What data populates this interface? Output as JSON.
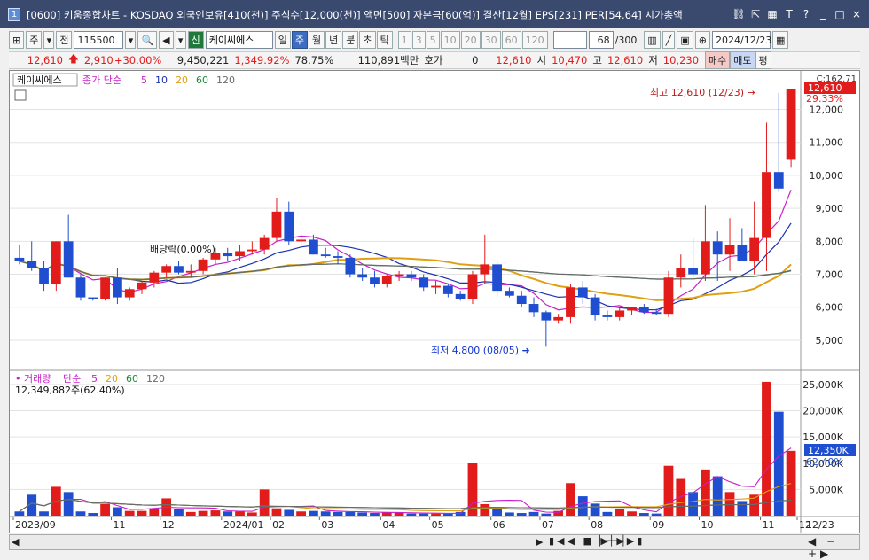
{
  "window": {
    "num": "1",
    "title": "[0600] 키움종합차트 - KOSDAQ 외국인보유[410(천)] 주식수[12,000(천)] 액면[500] 자본금[60(억)] 결산[12월] EPS[231] PER[54.64] 시가총액"
  },
  "toolbar": {
    "period_sel": "주",
    "prev_label": "전",
    "code": "115500",
    "credit_label": "신",
    "stock_name": "케이씨에스",
    "tabs": [
      "일",
      "주",
      "월",
      "년",
      "분",
      "초",
      "틱"
    ],
    "active_tab": "주",
    "nums": [
      "1",
      "3",
      "5",
      "10",
      "20",
      "30",
      "60",
      "120"
    ],
    "count": "68",
    "count_total": "/300",
    "date": "2024/12/23"
  },
  "quote": {
    "price": "12,610",
    "change": "2,910",
    "change_pct": "+30.00%",
    "volume": "9,450,221",
    "vol_ratio": "1,349.92%",
    "turnover": "78.75%",
    "amount": "110,891백만",
    "hoga_label": "호가",
    "hoga": "0",
    "last": "12,610",
    "open_label": "시",
    "open": "10,470",
    "high_label": "고",
    "high": "12,610",
    "low_label": "저",
    "low": "10,230",
    "buy": "매수",
    "sell": "매도",
    "flat": "평"
  },
  "price_panel": {
    "name": "케이씨에스",
    "legend_label": "종가 단순",
    "ma_labels": [
      "5",
      "10",
      "20",
      "60",
      "120"
    ],
    "ma_colors": [
      "#c81fc8",
      "#1a32b0",
      "#e0a012",
      "#1f8a3a",
      "#6a6a6a"
    ],
    "ex_div": "배당락(0.00%)",
    "high_note": "최고 12,610 (12/23)",
    "low_note": "최저 4,800 (08/05)",
    "current_tag": "12,610",
    "pct_tag": "29.33%",
    "top_label": "C:162.71"
  },
  "volume_panel": {
    "legend_name": "거래량",
    "legend_label": "단순",
    "ma_labels": [
      "5",
      "20",
      "60",
      "120"
    ],
    "value_text": "12,349,882주(62.40%)",
    "current_tag": "12,350K",
    "pct_tag": "62.40%"
  },
  "x_axis": {
    "labels": [
      "2023/09",
      "11",
      "12",
      "2024/01",
      "02",
      "03",
      "04",
      "05",
      "06",
      "07",
      "08",
      "09",
      "10",
      "11",
      "12"
    ],
    "right_label": "12/23"
  },
  "chart_data": {
    "type": "candlestick",
    "price_axis": [
      5000,
      6000,
      7000,
      8000,
      9000,
      10000,
      11000,
      12000
    ],
    "price_axis_labels": [
      "5,000",
      "6,000",
      "7,000",
      "8,000",
      "9,000",
      "10,000",
      "11,000",
      "12,000"
    ],
    "volume_axis": [
      5000,
      10000,
      15000,
      20000,
      25000
    ],
    "volume_axis_labels": [
      "5,000K",
      "10,000K",
      "15,000K",
      "20,000K",
      "25,000K"
    ],
    "candles": [
      [
        7500,
        7900,
        7300,
        7400,
        800
      ],
      [
        7400,
        8000,
        7100,
        7200,
        4000
      ],
      [
        7200,
        7400,
        6500,
        6700,
        800
      ],
      [
        6700,
        8000,
        6500,
        8000,
        5500
      ],
      [
        8000,
        8800,
        6900,
        6900,
        4500
      ],
      [
        6900,
        7000,
        6200,
        6300,
        800
      ],
      [
        6300,
        6300,
        6200,
        6250,
        500
      ],
      [
        6250,
        6900,
        6200,
        6900,
        2200
      ],
      [
        6900,
        7200,
        6100,
        6300,
        1600
      ],
      [
        6300,
        6600,
        6200,
        6550,
        900
      ],
      [
        6550,
        6800,
        6400,
        6750,
        900
      ],
      [
        6750,
        7100,
        6600,
        7050,
        1300
      ],
      [
        7050,
        7300,
        6900,
        7250,
        3300
      ],
      [
        7250,
        7400,
        7000,
        7050,
        1200
      ],
      [
        7050,
        7300,
        6900,
        7100,
        700
      ],
      [
        7100,
        7500,
        7000,
        7450,
        900
      ],
      [
        7450,
        7800,
        7300,
        7650,
        1000
      ],
      [
        7650,
        7800,
        7400,
        7550,
        800
      ],
      [
        7550,
        7900,
        7400,
        7700,
        800
      ],
      [
        7700,
        8000,
        7600,
        7750,
        600
      ],
      [
        7750,
        8200,
        7600,
        8100,
        5000
      ],
      [
        8100,
        9300,
        8000,
        8900,
        1400
      ],
      [
        8900,
        9200,
        7900,
        8000,
        1100
      ],
      [
        8000,
        8200,
        7900,
        8050,
        800
      ],
      [
        8050,
        8200,
        7600,
        7600,
        900
      ],
      [
        7600,
        7800,
        7500,
        7550,
        800
      ],
      [
        7550,
        7700,
        7300,
        7500,
        700
      ],
      [
        7500,
        7600,
        6900,
        7000,
        700
      ],
      [
        7000,
        7200,
        6800,
        6900,
        600
      ],
      [
        6900,
        7100,
        6600,
        6700,
        500
      ],
      [
        6700,
        7000,
        6600,
        6950,
        600
      ],
      [
        6950,
        7100,
        6800,
        7000,
        600
      ],
      [
        7000,
        7100,
        6800,
        6900,
        400
      ],
      [
        6900,
        7000,
        6500,
        6600,
        400
      ],
      [
        6600,
        6800,
        6400,
        6650,
        400
      ],
      [
        6650,
        6700,
        6300,
        6400,
        400
      ],
      [
        6400,
        6500,
        6200,
        6250,
        700
      ],
      [
        6250,
        7100,
        6100,
        7000,
        10000
      ],
      [
        7000,
        8200,
        6700,
        7300,
        2200
      ],
      [
        7300,
        7400,
        6300,
        6500,
        1200
      ],
      [
        6500,
        6600,
        6300,
        6350,
        600
      ],
      [
        6350,
        6500,
        6000,
        6100,
        500
      ],
      [
        6100,
        6300,
        5700,
        5850,
        700
      ],
      [
        5850,
        5900,
        4800,
        5600,
        400
      ],
      [
        5600,
        5800,
        5500,
        5700,
        900
      ],
      [
        5700,
        6700,
        5500,
        6600,
        6200
      ],
      [
        6600,
        6800,
        6100,
        6300,
        3700
      ],
      [
        6300,
        6400,
        5600,
        5750,
        2300
      ],
      [
        5750,
        5900,
        5600,
        5700,
        700
      ],
      [
        5700,
        6000,
        5600,
        5900,
        1200
      ],
      [
        5900,
        6000,
        5750,
        6000,
        800
      ],
      [
        6000,
        6100,
        5800,
        5850,
        500
      ],
      [
        5850,
        5950,
        5750,
        5800,
        400
      ],
      [
        5800,
        7100,
        5700,
        6900,
        9500
      ],
      [
        6900,
        7600,
        6600,
        7200,
        7000
      ],
      [
        7200,
        8100,
        6900,
        7000,
        4500
      ],
      [
        7000,
        9100,
        6800,
        8000,
        8800
      ],
      [
        8000,
        8300,
        6800,
        7600,
        7500
      ],
      [
        7600,
        8700,
        7100,
        7900,
        4500
      ],
      [
        7900,
        8400,
        7400,
        7400,
        2800
      ],
      [
        7400,
        9200,
        7000,
        8100,
        4000
      ],
      [
        8100,
        11600,
        7100,
        10100,
        25500
      ],
      [
        10100,
        12500,
        9500,
        9600,
        19800
      ],
      [
        10470,
        12610,
        10230,
        12610,
        12350
      ]
    ]
  }
}
